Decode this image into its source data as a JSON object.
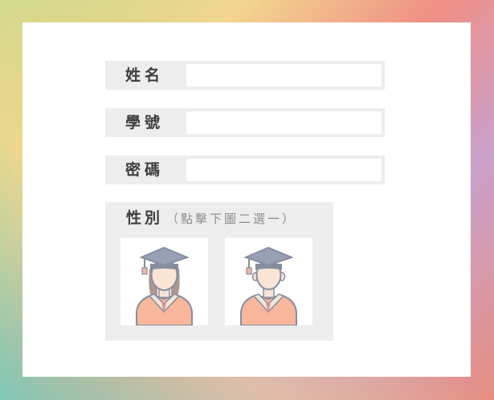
{
  "form": {
    "name": {
      "label": "姓名",
      "value": "",
      "placeholder": ""
    },
    "student_id": {
      "label": "學號",
      "value": "",
      "placeholder": ""
    },
    "password": {
      "label": "密碼",
      "value": "",
      "placeholder": ""
    }
  },
  "gender": {
    "label": "性別",
    "hint": "（點擊下圖二選一）",
    "options": [
      {
        "icon": "female-graduate-icon"
      },
      {
        "icon": "male-graduate-icon"
      }
    ]
  },
  "colors": {
    "card_bg": "#ffffff",
    "field_bg": "#ededed",
    "label_text": "#3e3e3e",
    "hint_text": "#8d8d8d",
    "gown": "#f58b5f",
    "cap": "#3c4a63",
    "skin": "#f6d4bd"
  }
}
